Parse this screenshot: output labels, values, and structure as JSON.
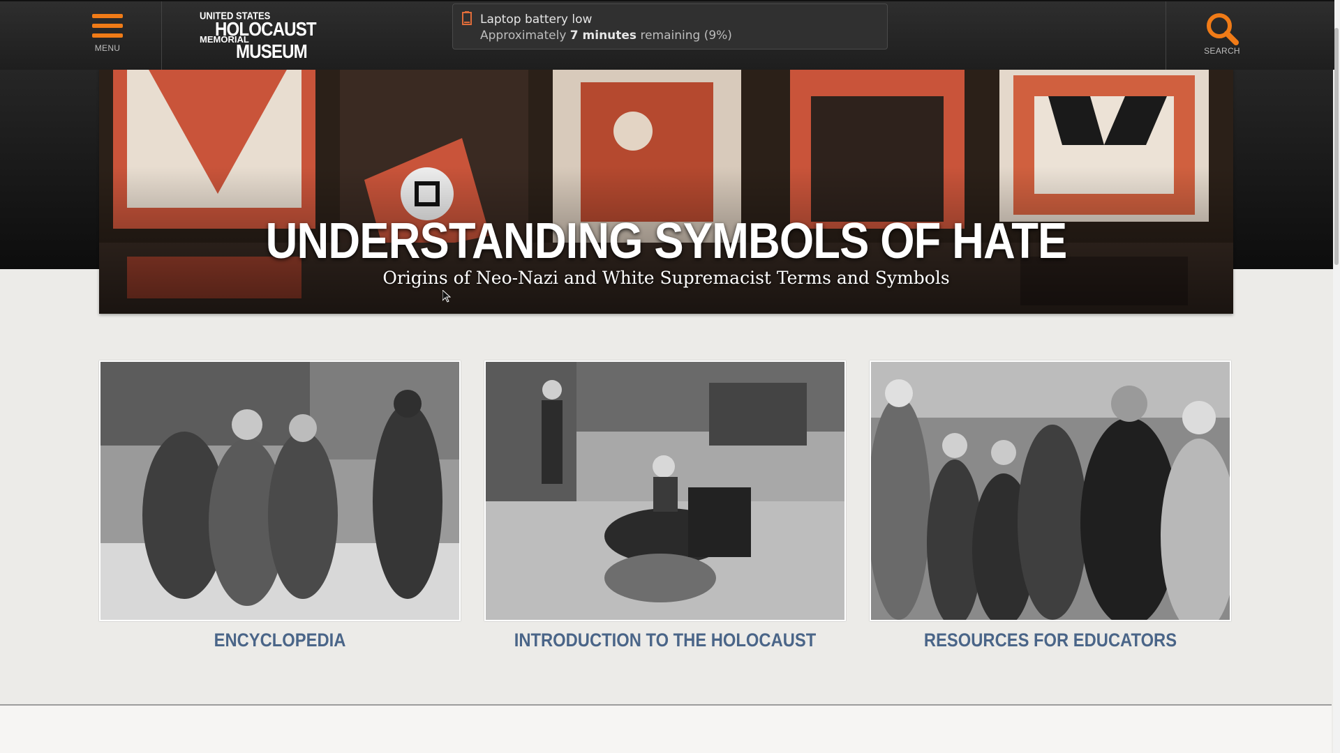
{
  "header": {
    "menu_label": "MENU",
    "search_label": "SEARCH",
    "logo": {
      "line1": "UNITED STATES",
      "line2": "HOLOCAUST",
      "line3": "MEMORIAL",
      "line4": "MUSEUM"
    }
  },
  "notification": {
    "title": "Laptop battery low",
    "body_prefix": "Approximately ",
    "body_bold": "7 minutes",
    "body_suffix": " remaining (9%)"
  },
  "hero": {
    "title": "UNDERSTANDING SYMBOLS OF HATE",
    "subtitle": "Origins of Neo-Nazi and White Supremacist Terms and Symbols"
  },
  "cards": [
    {
      "label": "ENCYCLOPEDIA"
    },
    {
      "label": "INTRODUCTION TO THE HOLOCAUST"
    },
    {
      "label": "RESOURCES FOR EDUCATORS"
    }
  ],
  "colors": {
    "accent": "#f07b17",
    "card_link": "#4a6588",
    "header_bg": "#2a2a2a",
    "page_bg": "#ecebe8"
  },
  "icons": [
    "hamburger-menu-icon",
    "search-icon",
    "battery-low-icon",
    "mouse-cursor-icon"
  ]
}
